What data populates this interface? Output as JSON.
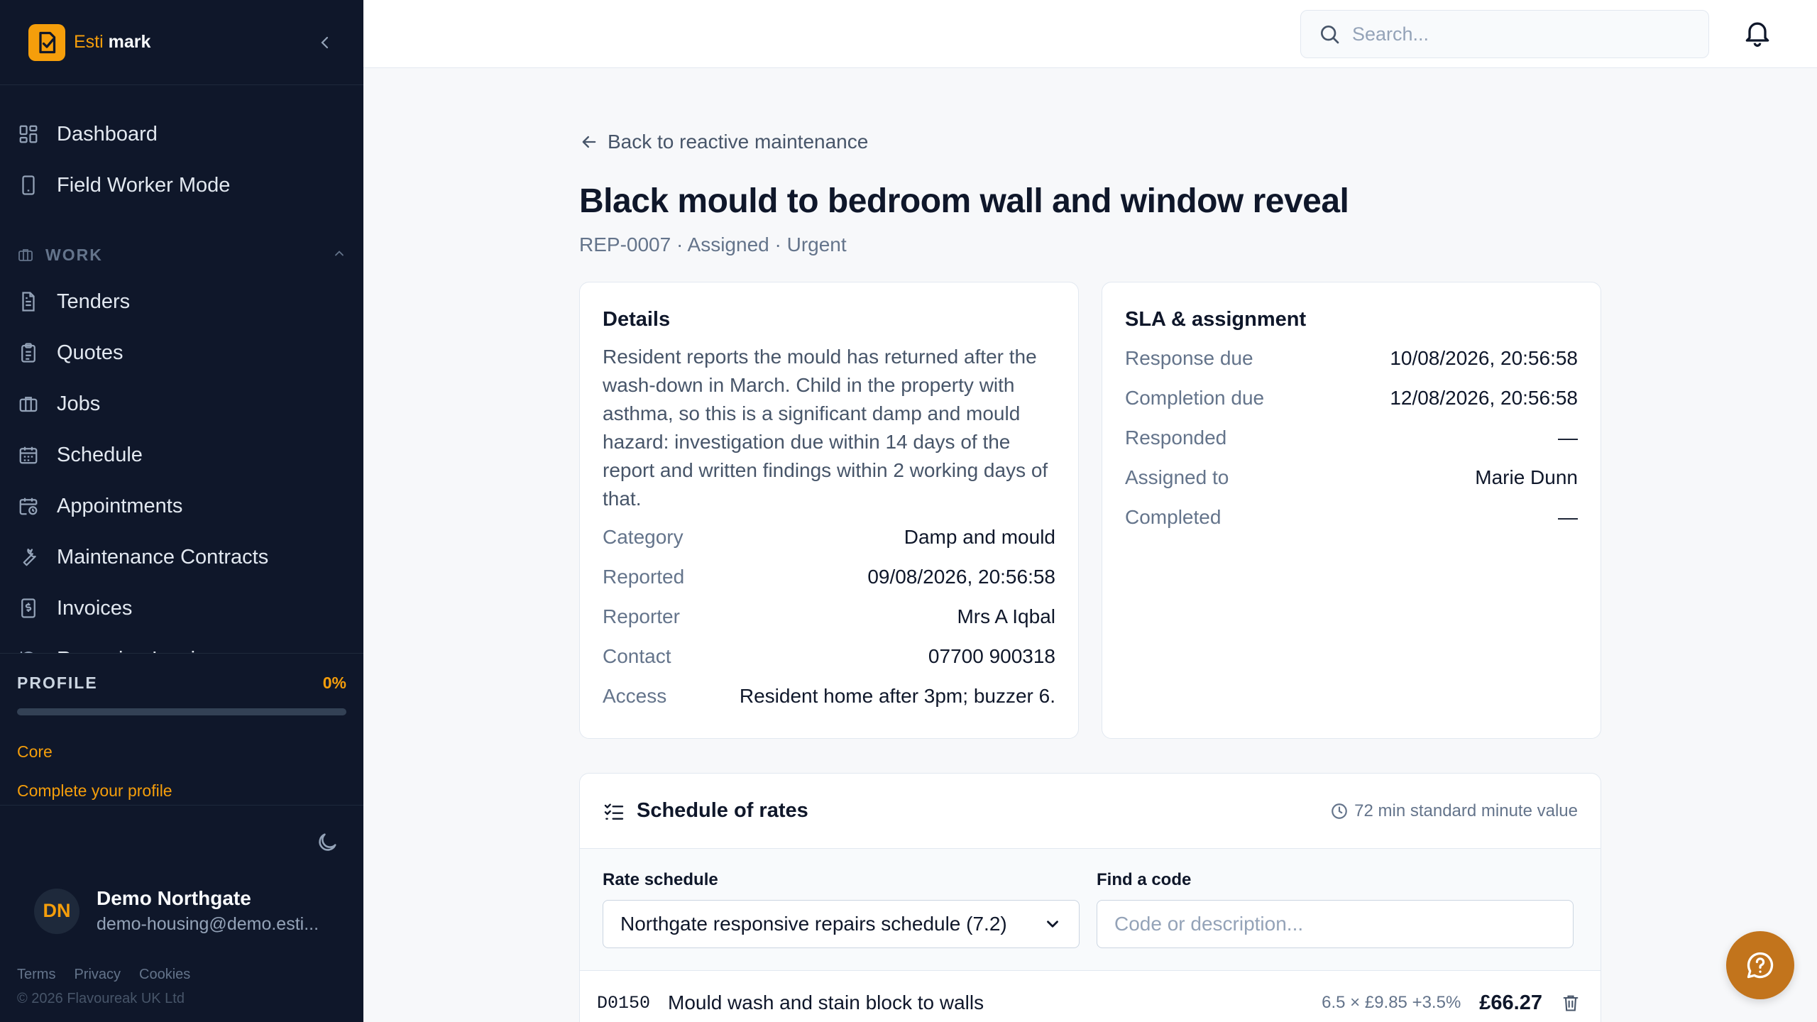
{
  "brand": {
    "part1": "Esti",
    "part2": "mark"
  },
  "nav": {
    "top": [
      {
        "label": "Dashboard",
        "icon": "dashboard-icon"
      },
      {
        "label": "Field Worker Mode",
        "icon": "phone-icon"
      }
    ],
    "section": "WORK",
    "items": [
      {
        "label": "Tenders",
        "icon": "document-icon"
      },
      {
        "label": "Quotes",
        "icon": "clipboard-icon"
      },
      {
        "label": "Jobs",
        "icon": "briefcase-icon"
      },
      {
        "label": "Schedule",
        "icon": "calendar-icon"
      },
      {
        "label": "Appointments",
        "icon": "calendar-clock-icon"
      },
      {
        "label": "Maintenance Contracts",
        "icon": "wrench-icon"
      },
      {
        "label": "Invoices",
        "icon": "invoice-icon"
      },
      {
        "label": "Recurring Invoices",
        "icon": "refresh-icon"
      }
    ]
  },
  "profile": {
    "title": "PROFILE",
    "percent_label": "0%",
    "progress": 0,
    "tier": "Core",
    "cta": "Complete your profile"
  },
  "user": {
    "initials": "DN",
    "name": "Demo Northgate",
    "email": "demo-housing@demo.esti..."
  },
  "legal": {
    "terms": "Terms",
    "privacy": "Privacy",
    "cookies": "Cookies",
    "copyright": "© 2026 Flavoureak UK Ltd"
  },
  "search": {
    "placeholder": "Search..."
  },
  "page": {
    "back": "Back to reactive maintenance",
    "title": "Black mould to bedroom wall and window reveal",
    "meta": "REP-0007 · Assigned · Urgent"
  },
  "details": {
    "title": "Details",
    "description": "Resident reports the mould has returned after the wash-down in March. Child in the property with asthma, so this is a significant damp and mould hazard: investigation due within 14 days of the report and written findings within 2 working days of that.",
    "rows": [
      {
        "k": "Category",
        "v": "Damp and mould"
      },
      {
        "k": "Reported",
        "v": "09/08/2026, 20:56:58"
      },
      {
        "k": "Reporter",
        "v": "Mrs A Iqbal"
      },
      {
        "k": "Contact",
        "v": "07700 900318"
      },
      {
        "k": "Access",
        "v": "Resident home after 3pm; buzzer 6."
      }
    ]
  },
  "sla": {
    "title": "SLA & assignment",
    "rows": [
      {
        "k": "Response due",
        "v": "10/08/2026, 20:56:58"
      },
      {
        "k": "Completion due",
        "v": "12/08/2026, 20:56:58"
      },
      {
        "k": "Responded",
        "v": "—"
      },
      {
        "k": "Assigned to",
        "v": "Marie Dunn"
      },
      {
        "k": "Completed",
        "v": "—"
      }
    ]
  },
  "sor": {
    "title": "Schedule of rates",
    "smv": "72 min standard minute value",
    "rate_schedule_label": "Rate schedule",
    "rate_schedule_value": "Northgate responsive repairs schedule (7.2)",
    "find_label": "Find a code",
    "find_placeholder": "Code or description...",
    "lines": [
      {
        "code": "D0150",
        "desc": "Mould wash and stain block to walls",
        "calc": "6.5 × £9.85 +3.5%",
        "price": "£66.27"
      }
    ]
  },
  "colors": {
    "accent": "#f59e0b",
    "sidebar": "#0f172a",
    "help": "#c2741c"
  }
}
